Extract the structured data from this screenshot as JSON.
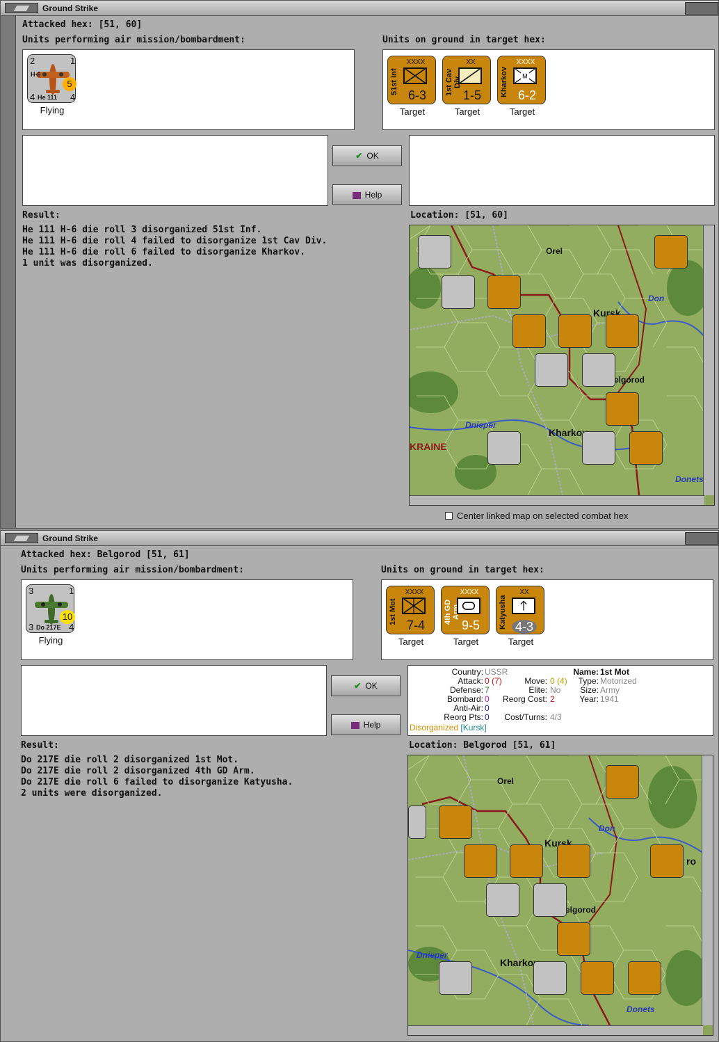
{
  "w1": {
    "title": "Ground Strike",
    "attacked_label": "Attacked hex:",
    "attacked_value": "[51, 60]",
    "air_units_label": "Units performing air mission/bombardment:",
    "ground_units_label": "Units on ground in target hex:",
    "air_unit": {
      "name": "He 111",
      "variant": "H-6",
      "n1": "2",
      "n2": "1",
      "n3": "4",
      "n4": "4",
      "range": "5",
      "status": "Flying"
    },
    "ground_units": [
      {
        "name": "51st Inf",
        "echelon": "XXXX",
        "stats": "6-3",
        "status": "Target"
      },
      {
        "name": "1st Cav Div",
        "echelon": "XX",
        "stats": "1-5",
        "status": "Target"
      },
      {
        "name": "Kharkov",
        "echelon": "XXXX",
        "stats": "6-2",
        "status": "Target"
      }
    ],
    "ok_label": "OK",
    "help_label": "Help",
    "result_label": "Result:",
    "results": [
      "He 111 H-6 die roll 3 disorganized 51st Inf.",
      "He 111 H-6 die roll 4 failed to disorganize 1st Cav Div.",
      "He 111 H-6 die roll 6 failed to disorganize Kharkov.",
      "1 unit was disorganized."
    ],
    "location_label": "Location:",
    "location_value": "[51, 60]",
    "center_label": "Center linked map on selected combat hex",
    "map_labels": [
      "Orel",
      "Kursk",
      "Don",
      "elgorod",
      "Dnieper",
      "Kharkov",
      "KRAINE",
      "Donets"
    ]
  },
  "w2": {
    "title": "Ground Strike",
    "attacked_label": "Attacked hex:",
    "attacked_value": "Belgorod  [51, 61]",
    "air_units_label": "Units performing air mission/bombardment:",
    "ground_units_label": "Units on ground in target hex:",
    "air_unit": {
      "name": "Do 217E",
      "variant": "",
      "n1": "3",
      "n2": "1",
      "n3": "3",
      "n4": "4",
      "range": "10",
      "status": "Flying"
    },
    "ground_units": [
      {
        "name": "1st Mot",
        "echelon": "XXXX",
        "stats": "7-4",
        "status": "Target"
      },
      {
        "name": "4th GD Arm",
        "echelon": "XXXX",
        "stats": "9-5",
        "status": "Target"
      },
      {
        "name": "Katyusha",
        "echelon": "XX",
        "stats": "4-3",
        "status": "Target"
      }
    ],
    "ok_label": "OK",
    "help_label": "Help",
    "info": {
      "country_label": "Country:",
      "country": "USSR",
      "attack_label": "Attack:",
      "attack": "0",
      "attack_paren": "(7)",
      "defense_label": "Defense:",
      "defense": "7",
      "bombard_label": "Bombard:",
      "bombard": "0",
      "antiair_label": "Anti-Air:",
      "antiair": "0",
      "reorgpts_label": "Reorg Pts:",
      "reorgpts": "0",
      "move_label": "Move:",
      "move": "0",
      "move_paren": "(4)",
      "elite_label": "Elite:",
      "elite": "No",
      "reorgcost_label": "Reorg Cost:",
      "reorgcost": "2",
      "costturns_label": "Cost/Turns:",
      "costturns": "4/3",
      "name_label": "Name:",
      "name": "1st Mot",
      "type_label": "Type:",
      "type": "Motorized",
      "size_label": "Size:",
      "size": "Army",
      "year_label": "Year:",
      "year": "1941",
      "disorg": "Disorganized",
      "disorg_loc": "[Kursk]"
    },
    "result_label": "Result:",
    "results": [
      "Do 217E die roll 2 disorganized 1st Mot.",
      "Do 217E die roll 2 disorganized 4th GD Arm.",
      "Do 217E die roll 6 failed to disorganize Katyusha.",
      "2 units were disorganized."
    ],
    "location_label": "Location:",
    "location_value": "Belgorod  [51, 61]",
    "map_labels": [
      "Orel",
      "Kursk",
      "Don",
      "elgorod",
      "Dnieper",
      "Kharkov",
      "Donets",
      "ro"
    ]
  },
  "colors": {
    "counter_tan": "#c8860c",
    "counter_grey": "#c2c2c2",
    "map_green": "#8ca55a",
    "river": "#3a5ac8",
    "border": "#8a1a1a"
  }
}
